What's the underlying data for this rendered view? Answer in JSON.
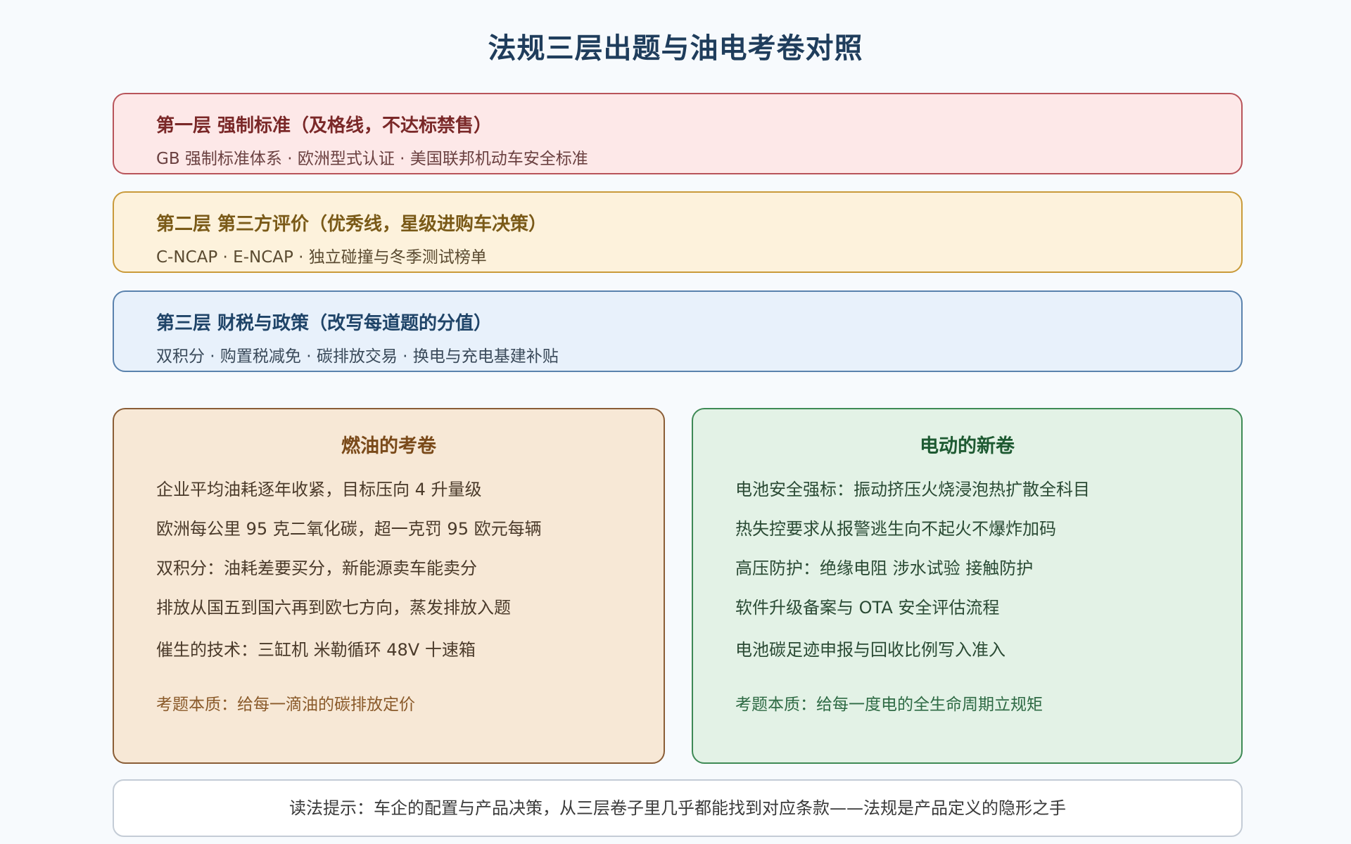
{
  "title": "法规三层出题与油电考卷对照",
  "layers": [
    {
      "title": "第一层 强制标准（及格线，不达标禁售）",
      "subtitle": "GB 强制标准体系 · 欧洲型式认证 · 美国联邦机动车安全标准",
      "color": "#b8545a"
    },
    {
      "title": "第二层 第三方评价（优秀线，星级进购车决策）",
      "subtitle": "C-NCAP · E-NCAP · 独立碰撞与冬季测试榜单",
      "color": "#c99a3a"
    },
    {
      "title": "第三层 财税与政策（改写每道题的分值）",
      "subtitle": "双积分 · 购置税减免 · 碳排放交易 · 换电与充电基建补贴",
      "color": "#5a82ad"
    }
  ],
  "fuel": {
    "heading": "燃油的考卷",
    "items": [
      "企业平均油耗逐年收紧，目标压向 4 升量级",
      "欧洲每公里 95 克二氧化碳，超一克罚 95 欧元每辆",
      "双积分：油耗差要买分，新能源卖车能卖分",
      "排放从国五到国六再到欧七方向，蒸发排放入题",
      "催生的技术：三缸机 米勒循环 48V 十速箱"
    ],
    "essence": "考题本质：给每一滴油的碳排放定价",
    "color": "#8a5d36"
  },
  "ev": {
    "heading": "电动的新卷",
    "items": [
      "电池安全强标：振动挤压火烧浸泡热扩散全科目",
      "热失控要求从报警逃生向不起火不爆炸加码",
      "高压防护：绝缘电阻 涉水试验 接触防护",
      "软件升级备案与 OTA 安全评估流程",
      "电池碳足迹申报与回收比例写入准入"
    ],
    "essence": "考题本质：给每一度电的全生命周期立规矩",
    "color": "#3e8a55"
  },
  "hint": "读法提示：车企的配置与产品决策，从三层卷子里几乎都能找到对应条款——法规是产品定义的隐形之手"
}
